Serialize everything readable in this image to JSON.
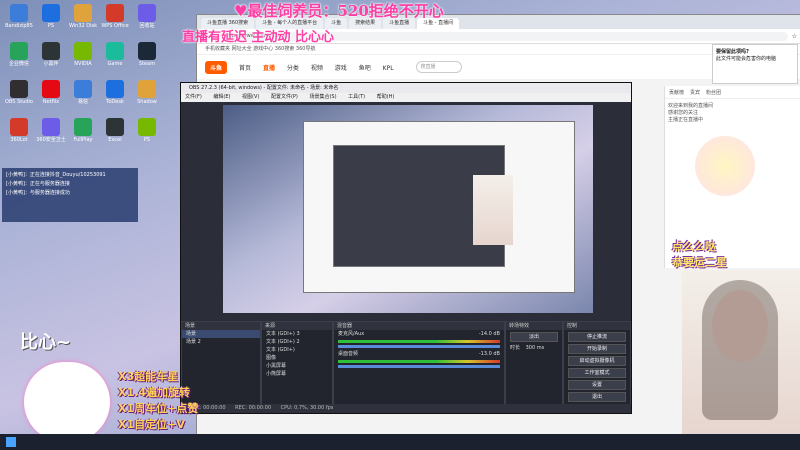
{
  "desktop": {
    "icons": [
      {
        "label": "Bandizip85"
      },
      {
        "label": "PS"
      },
      {
        "label": "Win32 Disk"
      },
      {
        "label": "WPS Office"
      },
      {
        "label": "回收站"
      },
      {
        "label": "企业微信"
      },
      {
        "label": "小黑伴"
      },
      {
        "label": "NVIDIA"
      },
      {
        "label": "Game"
      },
      {
        "label": "Steam"
      },
      {
        "label": "OBS Studio"
      },
      {
        "label": "Netflix"
      },
      {
        "label": "易信"
      },
      {
        "label": "ToDesk"
      },
      {
        "label": "Shadow"
      },
      {
        "label": "360Lot"
      },
      {
        "label": "360安全卫士"
      },
      {
        "label": "FullPlay"
      },
      {
        "label": "Excel"
      },
      {
        "label": "PS"
      }
    ],
    "notice": [
      "[小黄鸭]：正在连接抖音_Douyu/10253091",
      "[小黄鸭]：正在与服务器连接",
      "[小黄鸭]：与服务器连接成功"
    ]
  },
  "browser": {
    "tabs": [
      "斗鱼直播 360搜索",
      "斗鱼 - 每个人的直播平台",
      "斗鱼",
      "搜索结果",
      "斗鱼直播",
      "斗鱼 - 直播间"
    ],
    "address": "https://www.douyu.com/",
    "bookmarks": "手机收藏夹  网址大全  游戏中心  360搜索  360导航",
    "site_logo": "斗鱼",
    "nav": [
      "首页",
      "直播",
      "分类",
      "视频",
      "游戏",
      "鱼吧",
      "KPL"
    ],
    "active_nav": "直播",
    "search_placeholder": "搜直播",
    "popup_title": "要保留此项吗?",
    "popup_text": "此文件可能会危害你的电脑",
    "chat_tabs": [
      "贡献榜",
      "贵宾",
      "粉丝团"
    ],
    "chat_lines": [
      "欢迎来到我的直播间",
      "感谢您的关注",
      "主播正在直播中"
    ]
  },
  "obs": {
    "title": "OBS 27.2.3 (64-bit, windows) - 配置文件: 未命名 - 场景: 未命名",
    "menu": [
      "文件(F)",
      "编辑(E)",
      "视图(V)",
      "配置文件(P)",
      "场景集合(S)",
      "工具(T)",
      "帮助(H)"
    ],
    "scene_header": "场景",
    "scenes": [
      "场景",
      "场景 2"
    ],
    "sources_header": "来源",
    "sources": [
      "文本 (GDI+) 3",
      "文本 (GDI+) 2",
      "文本 (GDI+)",
      "图像",
      "小黑屏幕",
      "小熊屏幕"
    ],
    "mixer_header": "混音器",
    "mixer": [
      {
        "name": "麦克风/Aux",
        "db": "-14.0 dB"
      },
      {
        "name": "桌面音频",
        "db": "-13.0 dB"
      }
    ],
    "transition_header": "转场特效",
    "transition": "淡出",
    "duration_label": "时长",
    "duration": "300 ms",
    "controls_header": "控制",
    "controls": [
      "停止推流",
      "开始录制",
      "启动虚拟摄像机",
      "工作室模式",
      "设置",
      "退出"
    ],
    "status": [
      "LIVE: 00:00:00",
      "REC: 00:00:00",
      "CPU: 0.7%, 30.00 fps"
    ]
  },
  "overlay": {
    "banner": "♥最佳饲养员：520拒绝不开心",
    "sub": "直播有延迟  主动动 比心心",
    "right_top": "点么么哒",
    "right_mid": "恭要运二星",
    "heart_text": "比心~",
    "gifts": [
      "X3超能车星",
      "X1.4遍加旋转",
      "X1周车位+点赞",
      "X1自定位+V"
    ]
  },
  "colors": {
    "accent": "#ff5b00",
    "banner": "#ff3ea5",
    "gift": "#ffd35a"
  }
}
